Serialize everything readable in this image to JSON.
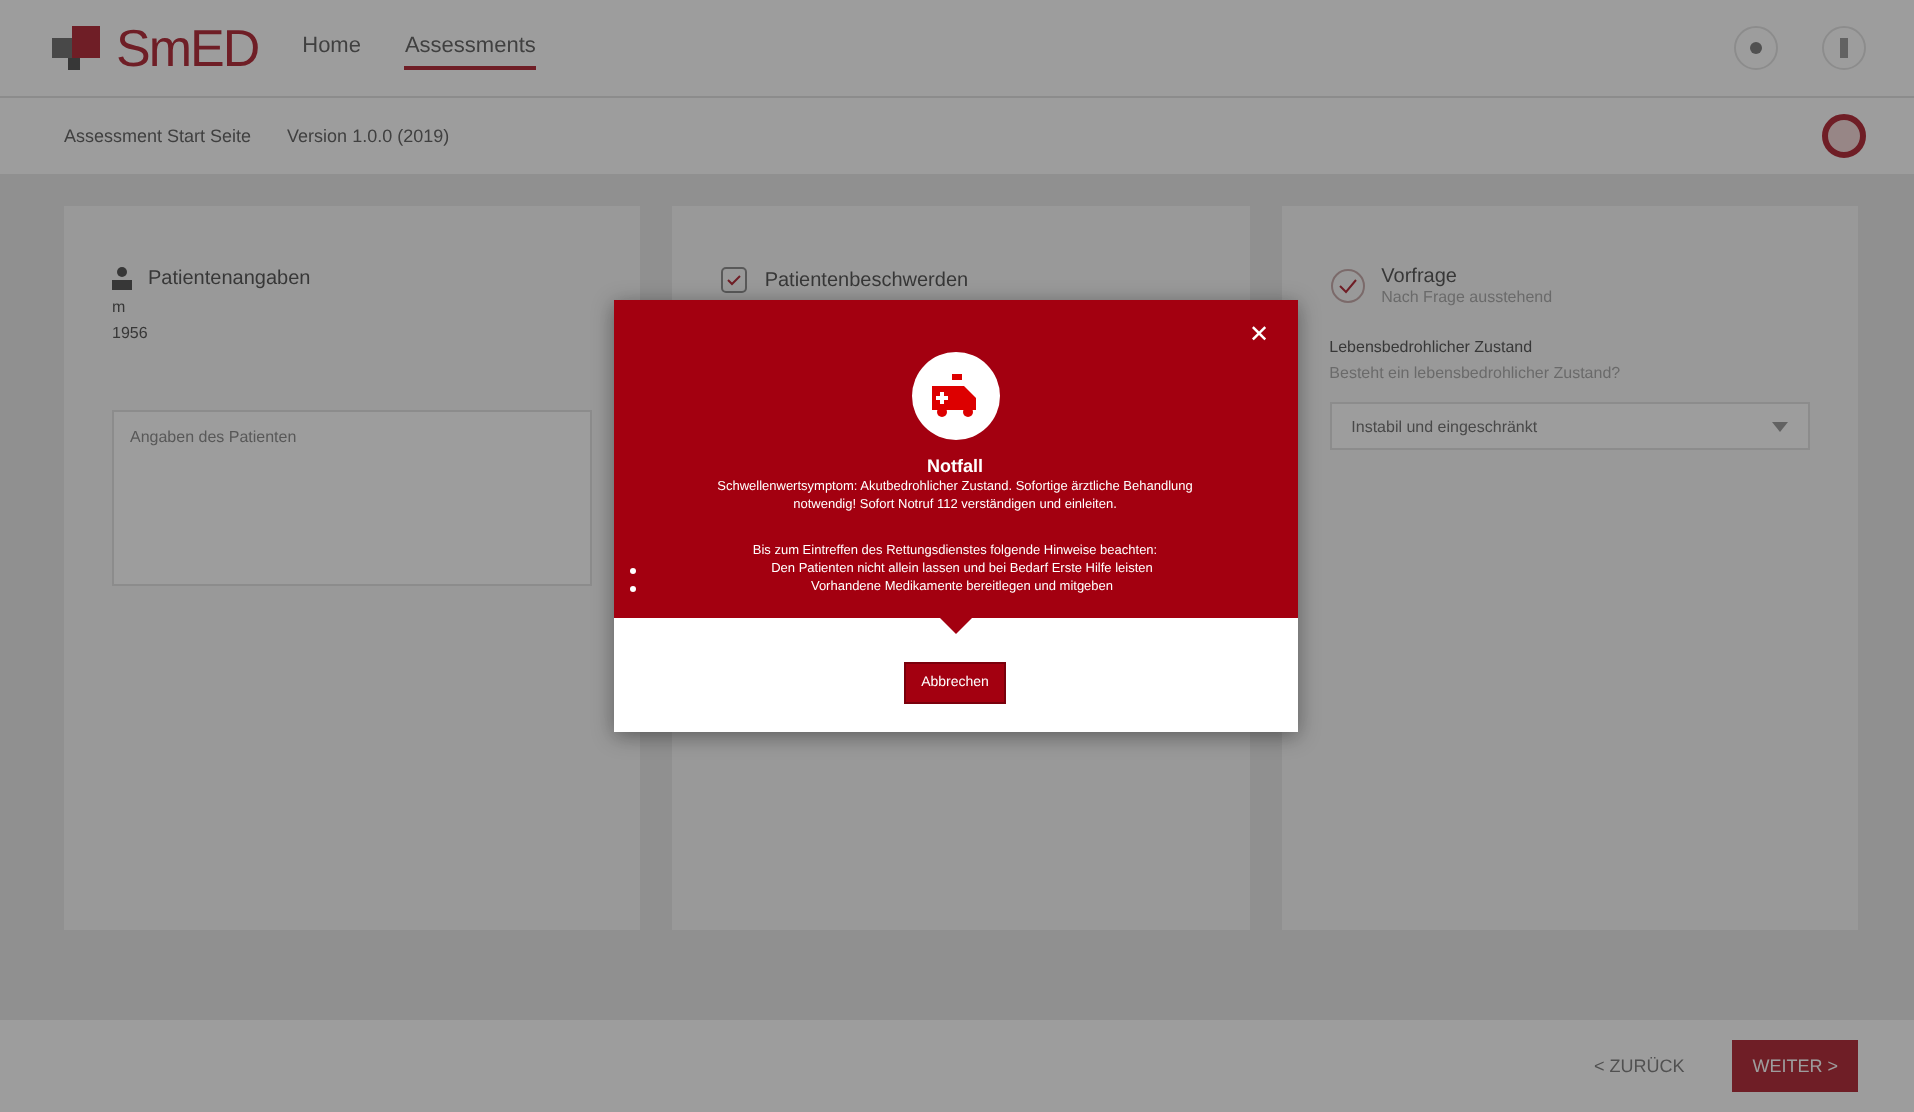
{
  "header": {
    "logo": "SmED",
    "nav": [
      {
        "label": "Home",
        "selected": false
      },
      {
        "label": "Assessments",
        "selected": true
      }
    ]
  },
  "subheader": {
    "breadcrumb": "Assessment Start Seite",
    "version": "Version 1.0.0 (2019)"
  },
  "cards": [
    {
      "kind": "patient",
      "title": "Patientenangaben",
      "lines": [
        "m",
        "1956"
      ],
      "placeholder": "Angaben des Patienten"
    },
    {
      "kind": "complaint",
      "title": "Patientenbeschwerden"
    },
    {
      "kind": "question",
      "title": "Vorfrage",
      "subtitle": "Nach Frage ausstehend",
      "label": "Lebensbedrohlicher Zustand",
      "hint": "Besteht ein lebensbedrohlicher Zustand?",
      "value": "Instabil und eingeschränkt"
    }
  ],
  "modal": {
    "title": "Notfall",
    "message": [
      "Schwellenwertsymptom: Akutbedrohlicher Zustand. Sofortige ärztliche Behandlung",
      "notwendig! Sofort Notruf 112 verständigen und einleiten."
    ],
    "intro": "Bis zum Eintreffen des Rettungsdienstes folgende Hinweise beachten:",
    "bullets": [
      "Den Patienten nicht allein lassen und bei Bedarf Erste Hilfe leisten",
      "Vorhandene Medikamente bereitlegen und mitgeben"
    ],
    "button": "Abbrechen",
    "close": "✕"
  },
  "footer": {
    "back": "< ZURÜCK",
    "next": "WEITER >"
  }
}
